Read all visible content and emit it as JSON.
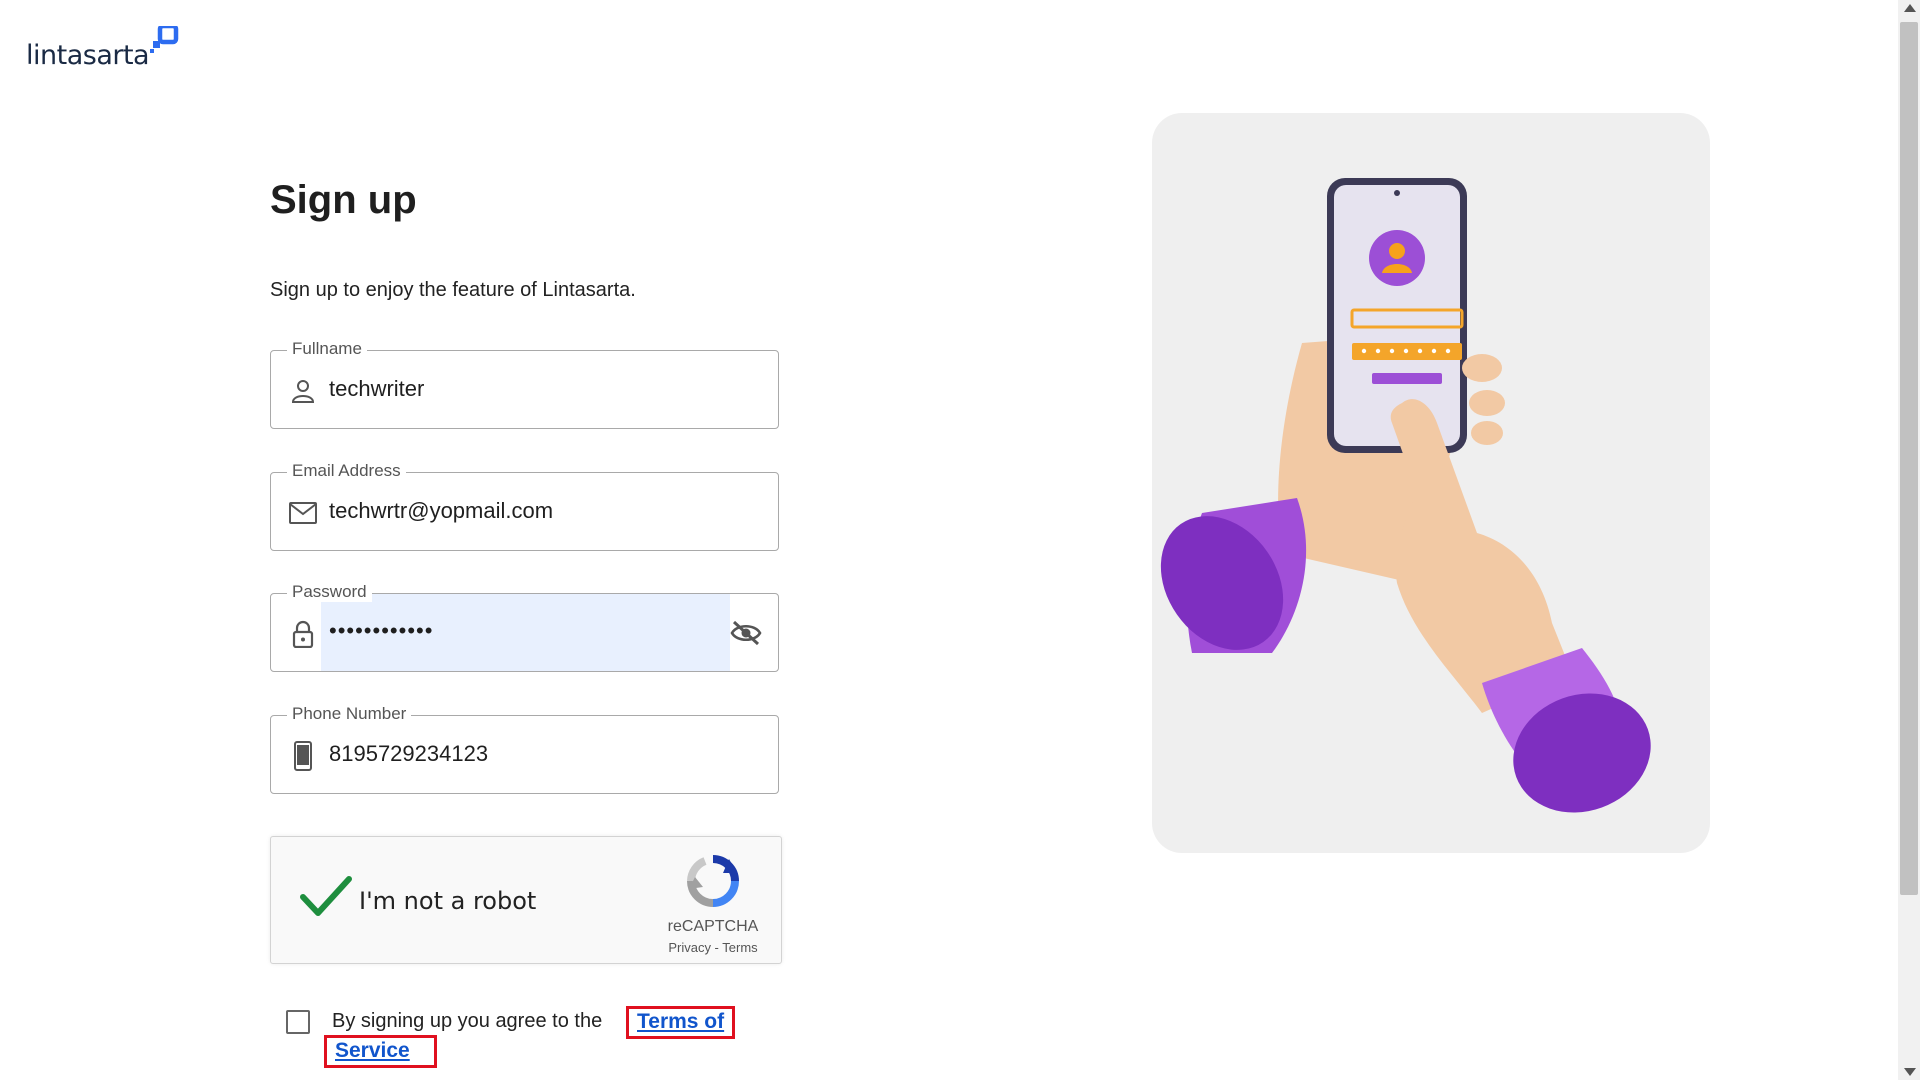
{
  "brand": {
    "logo_text": "lintasarta"
  },
  "form": {
    "title": "Sign up",
    "subtitle": "Sign up to enjoy the feature of Lintasarta.",
    "fields": [
      {
        "label": "Fullname",
        "value": "techwriter",
        "icon": "person-icon"
      },
      {
        "label": "Email Address",
        "value": "techwrtr@yopmail.com",
        "icon": "mail-icon"
      },
      {
        "label": "Password",
        "value": "••••••••••••",
        "icon": "lock-icon",
        "trailing_icon": "eye-off-icon"
      },
      {
        "label": "Phone Number",
        "value": "8195729234123",
        "icon": "phone-icon"
      }
    ]
  },
  "captcha": {
    "label": "I'm not a robot",
    "brand": "reCAPTCHA",
    "links": "Privacy - Terms",
    "checked": true
  },
  "terms": {
    "text": "By signing up you agree to the",
    "link_line1": "Terms of",
    "link_line2": "Service",
    "checked": false
  },
  "illustration": {
    "icon": "phone-login-illustration"
  },
  "colors": {
    "accent": "#1155cc",
    "brand": "#1a2a44",
    "highlight": "#e0101f",
    "purple": "#8b3fd0",
    "check": "#1e8e3e"
  }
}
